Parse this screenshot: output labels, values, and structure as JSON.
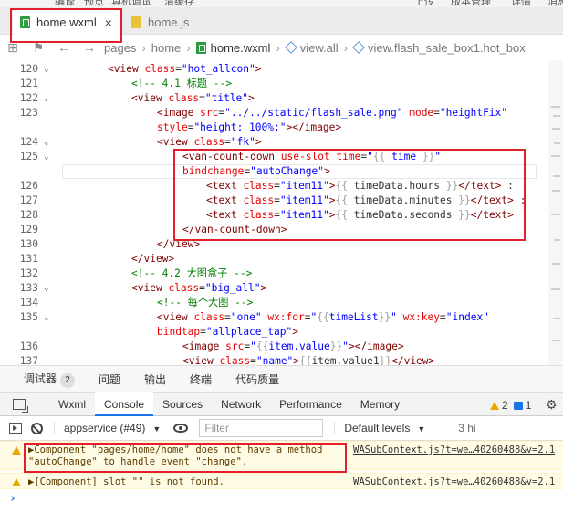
{
  "menu": {
    "items": [
      "编译",
      "预览",
      "真机调试",
      "清缓存",
      "上传",
      "版本管理",
      "详情",
      "消息"
    ]
  },
  "tabs": [
    {
      "label": "home.wxml",
      "close": "×"
    },
    {
      "label": "home.js"
    }
  ],
  "breadcrumb": {
    "back": "←",
    "forward": "→",
    "parts": [
      "pages",
      "home",
      "home.wxml",
      "view.all",
      "view.flash_sale_box1.hot_box"
    ]
  },
  "editor": {
    "lines": [
      {
        "n": "120",
        "fold": "⌄"
      },
      {
        "n": "121",
        "fold": ""
      },
      {
        "n": "122",
        "fold": "⌄"
      },
      {
        "n": "123",
        "fold": ""
      },
      {
        "n": "",
        "fold": ""
      },
      {
        "n": "124",
        "fold": "⌄"
      },
      {
        "n": "125",
        "fold": "⌄"
      },
      {
        "n": "",
        "fold": ""
      },
      {
        "n": "126",
        "fold": ""
      },
      {
        "n": "127",
        "fold": ""
      },
      {
        "n": "128",
        "fold": ""
      },
      {
        "n": "129",
        "fold": ""
      },
      {
        "n": "130",
        "fold": ""
      },
      {
        "n": "131",
        "fold": ""
      },
      {
        "n": "132",
        "fold": ""
      },
      {
        "n": "133",
        "fold": "⌄"
      },
      {
        "n": "134",
        "fold": ""
      },
      {
        "n": "135",
        "fold": "⌄"
      },
      {
        "n": "",
        "fold": ""
      },
      {
        "n": "136",
        "fold": ""
      },
      {
        "n": "137",
        "fold": ""
      }
    ]
  },
  "panel": {
    "tabs": [
      "调试器",
      "问题",
      "输出",
      "终端",
      "代码质量"
    ],
    "debugger_count": "2"
  },
  "devtools": {
    "tabs": [
      "Wxml",
      "Console",
      "Sources",
      "Network",
      "Performance",
      "Memory"
    ],
    "warnings": "2",
    "messages": "1"
  },
  "filterbar": {
    "context": "appservice (#49)",
    "filter_placeholder": "Filter",
    "levels": "Default levels",
    "hidden": "3 hi"
  },
  "console": {
    "messages": [
      {
        "text": "▶Component \"pages/home/home\" does not have a method\n\"autoChange\" to handle event \"change\".",
        "source": "WASubContext.js?t=we…40260488&v=2.1"
      },
      {
        "text": "▶[Component] slot \"\" is not found.",
        "source": "WASubContext.js?t=we…40260488&v=2.1"
      }
    ],
    "prompt": "›"
  },
  "colors": {
    "highlight_border": "#e0202a",
    "warning_bg": "#fffbe5",
    "active_tab": "#1a73e8"
  }
}
